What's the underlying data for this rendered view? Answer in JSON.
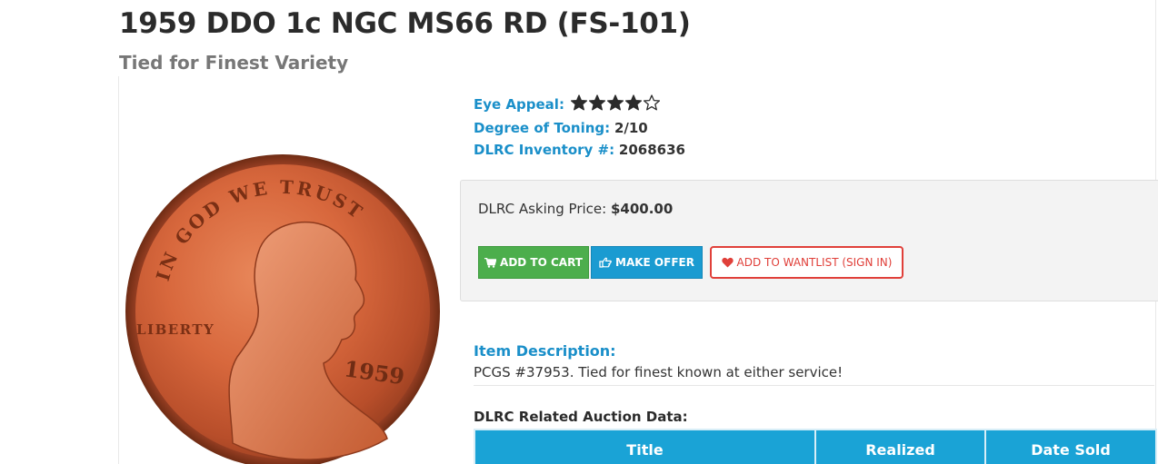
{
  "listing": {
    "title": "1959 DDO 1c NGC MS66 RD (FS-101)",
    "subtitle": "Tied for Finest Variety"
  },
  "coin_image": {
    "legend_top": "IN GOD WE TRUST",
    "legend_left": "LIBERTY",
    "date": "1959"
  },
  "attributes": {
    "eye_appeal_label": "Eye Appeal:",
    "eye_appeal_rating": 4,
    "eye_appeal_max": 5,
    "toning_label": "Degree of Toning:",
    "toning_value": "2/10",
    "inventory_label": "DLRC Inventory #:",
    "inventory_value": "2068636"
  },
  "pricing": {
    "asking_label": "DLRC Asking Price:",
    "asking_value": "$400.00",
    "add_to_cart_label": "ADD TO CART",
    "make_offer_label": "MAKE OFFER",
    "wantlist_label": "ADD TO WANTLIST (SIGN IN)"
  },
  "description": {
    "label": "Item Description:",
    "text": "PCGS #37953. Tied for finest known at either service!"
  },
  "auction_data": {
    "label": "DLRC Related Auction Data:",
    "columns": [
      "Title",
      "Realized",
      "Date Sold"
    ]
  },
  "colors": {
    "accent_blue": "#1a8fc9",
    "cart_green": "#4cae4c",
    "offer_blue": "#1a9bd1",
    "wantlist_red": "#e0403a",
    "table_header": "#1aa3d6",
    "star_fill": "#2b2b2b"
  },
  "icons": {
    "cart": "shopping-cart-icon",
    "offer": "hand-point-icon",
    "wantlist": "heart-icon",
    "star_filled": "star-filled-icon",
    "star_empty": "star-empty-icon"
  }
}
